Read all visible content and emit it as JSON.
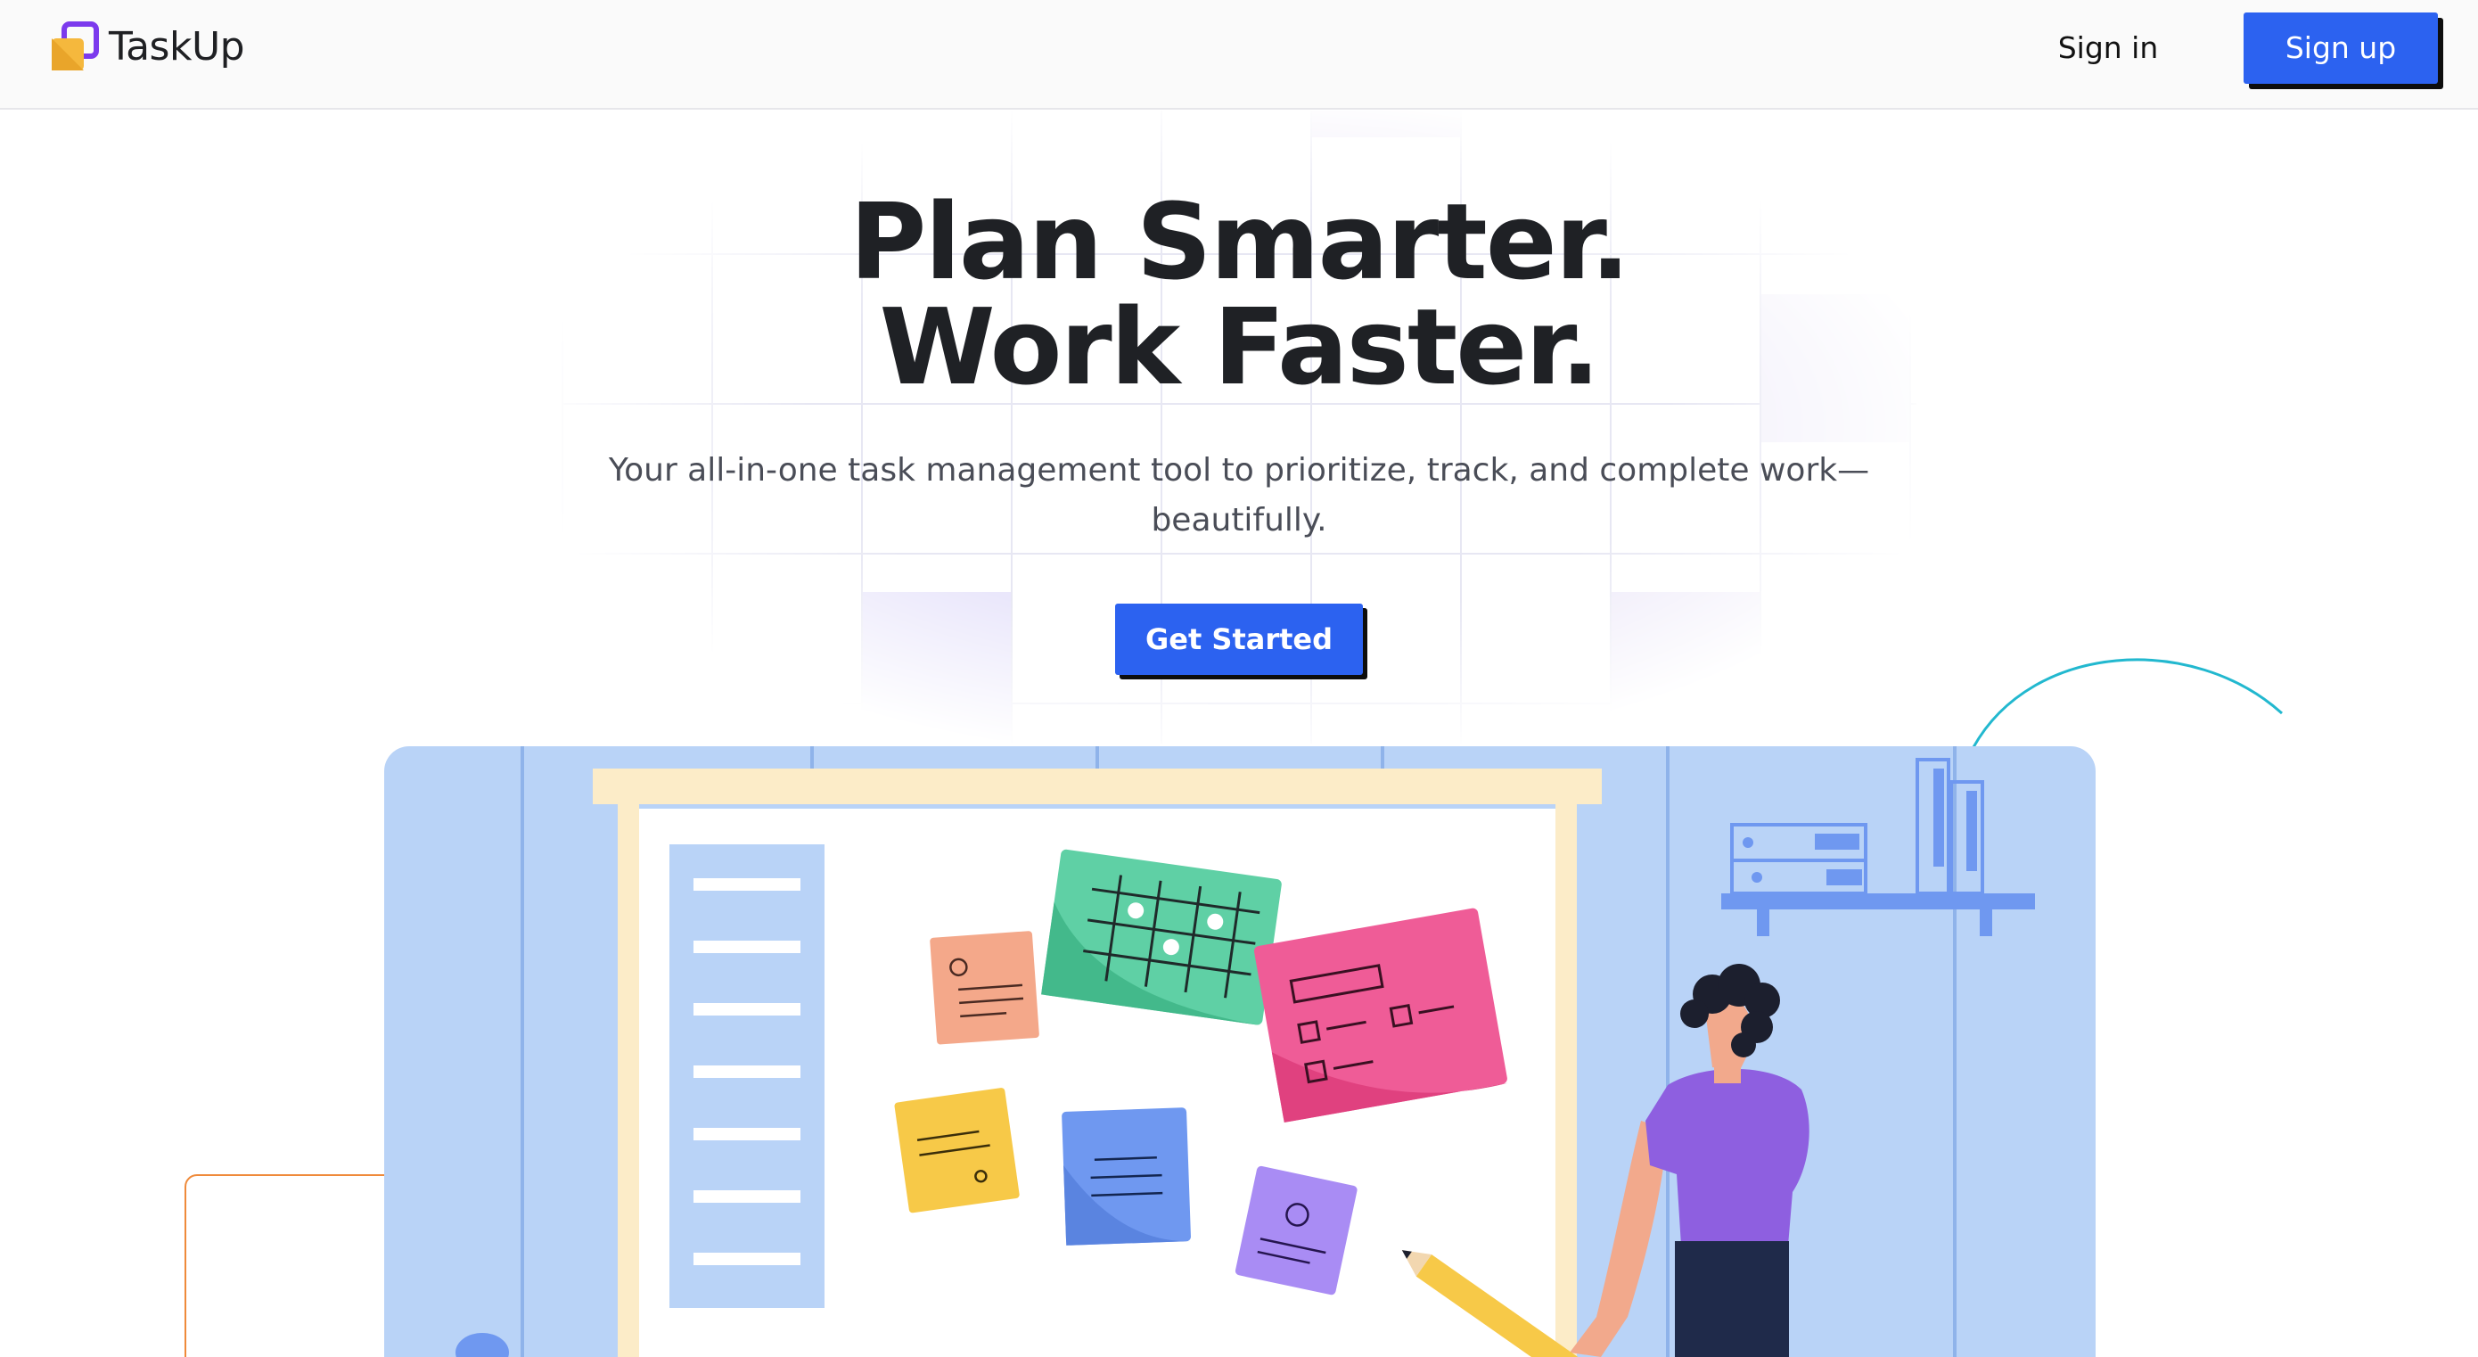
{
  "header": {
    "brand": "TaskUp",
    "signin_label": "Sign in",
    "signup_label": "Sign up"
  },
  "hero": {
    "headline_line1": "Plan Smarter.",
    "headline_line2": "Work Faster.",
    "subtitle": "Your all-in-one task management tool to prioritize, track, and complete work—beautifully.",
    "cta_label": "Get Started"
  },
  "icons": {
    "logo": "taskup-logo-icon"
  },
  "colors": {
    "accent": "#2c62f0",
    "heading": "#1f2125",
    "subtitle": "#4a4d57",
    "illustration_bg": "#b9d3f7",
    "logo_purple": "#7c3aed",
    "logo_yellow": "#f5b83d"
  }
}
